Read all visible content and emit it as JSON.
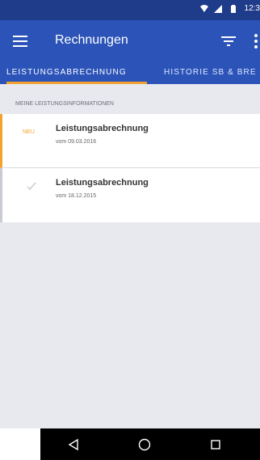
{
  "status_bar": {
    "time": "12:3"
  },
  "app_bar": {
    "title": "Rechnungen",
    "icons": [
      "menu-icon",
      "filter-icon",
      "more-icon"
    ]
  },
  "tabs": [
    {
      "label": "LEISTUNGSABRECHNUNG",
      "selected": true
    },
    {
      "label": "HISTORIE SB & BRE",
      "selected": false
    }
  ],
  "content": {
    "section_title": "MEINE LEISTUNGSINFORMATIONEN",
    "items": [
      {
        "badge": "NEU",
        "title": "Leistungsabrechnung",
        "date": "vom 09.03.2016"
      },
      {
        "badge": "",
        "title": "Leistungsabrechnung",
        "date": "vom 18.12.2015"
      }
    ]
  },
  "colors": {
    "status_bar": "#1f3c8a",
    "app_bar": "#2b53b8",
    "accent": "#f2a32b",
    "background": "#e8e9ee"
  }
}
